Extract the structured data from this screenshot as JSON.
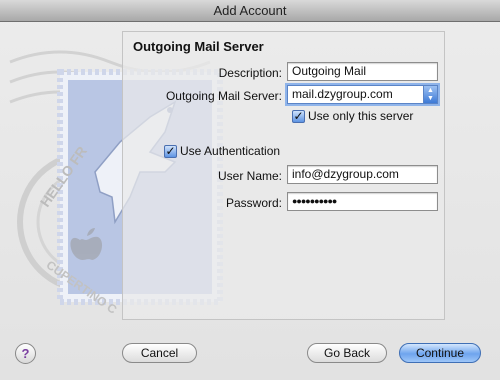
{
  "window": {
    "title": "Add Account"
  },
  "panel": {
    "title": "Outgoing Mail Server",
    "description": {
      "label": "Description:",
      "value": "Outgoing Mail"
    },
    "server": {
      "label": "Outgoing Mail Server:",
      "value": "mail.dzygroup.com"
    },
    "use_only": {
      "label": "Use only this server",
      "checked": true
    },
    "use_auth": {
      "label": "Use Authentication",
      "checked": true
    },
    "username": {
      "label": "User Name:",
      "value": "info@dzygroup.com"
    },
    "password": {
      "label": "Password:",
      "value": "●●●●●●●●●●"
    }
  },
  "stamp": {
    "postmark_top": "HELLO FR",
    "postmark_bottom": "CUPERTINO C"
  },
  "buttons": {
    "help": "?",
    "cancel": "Cancel",
    "back": "Go Back",
    "continue": "Continue"
  },
  "colors": {
    "accent": "#5b84c6",
    "checkbox": "#5d93e3",
    "stamp": "#b9c6e4"
  },
  "icons": {
    "stamp": "stamp-eagle-icon",
    "apple": "apple-icon",
    "dropdown": "chevron-down-icon",
    "help": "help-icon"
  }
}
